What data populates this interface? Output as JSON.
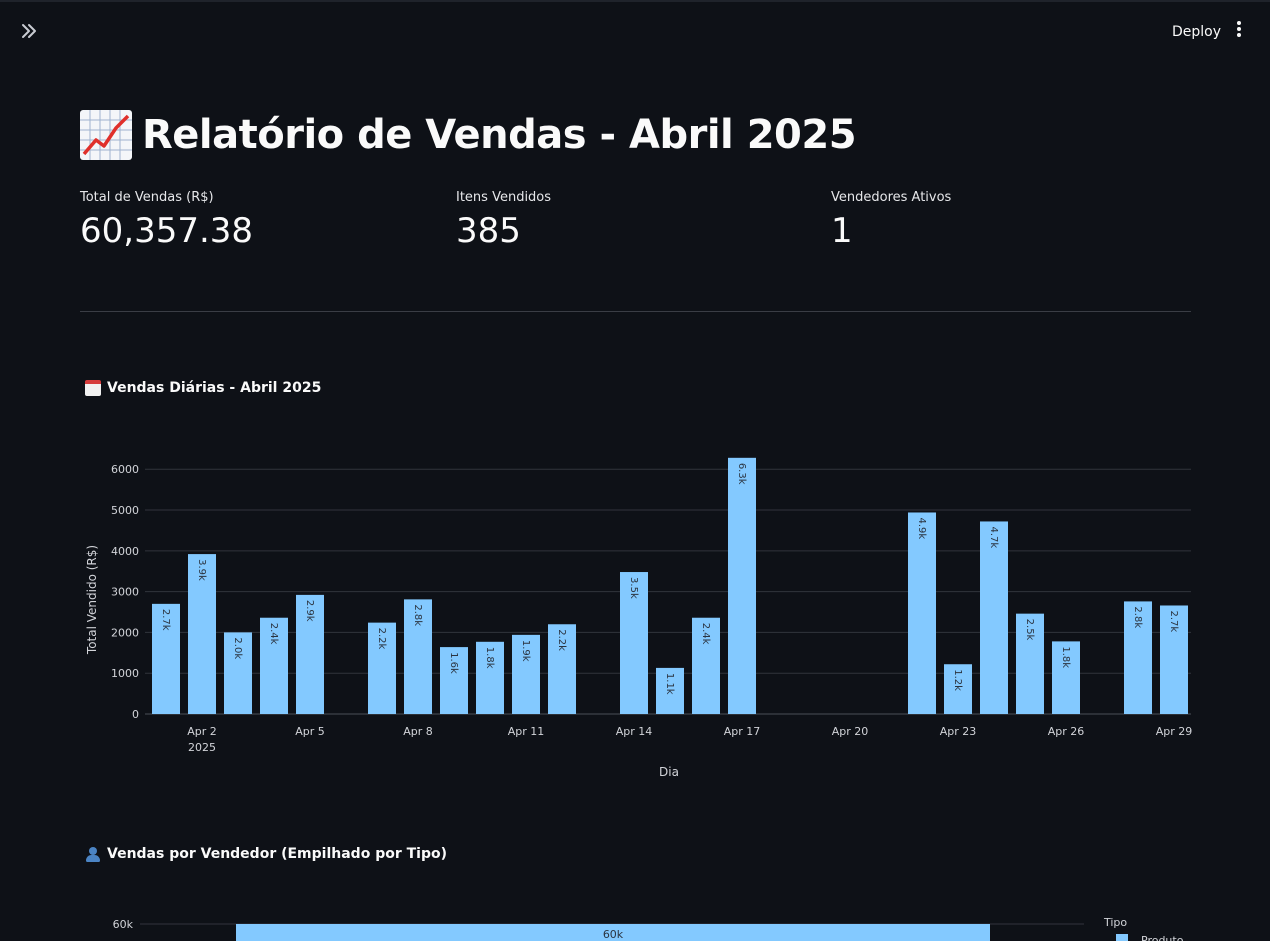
{
  "header": {
    "deploy_label": "Deploy"
  },
  "page": {
    "title": "Relatório de Vendas - Abril 2025"
  },
  "metrics": [
    {
      "label": "Total de Vendas (R$)",
      "value": "60,357.38"
    },
    {
      "label": "Itens Vendidos",
      "value": "385"
    },
    {
      "label": "Vendedores Ativos",
      "value": "1"
    }
  ],
  "sections": {
    "daily_title": "Vendas Diárias - Abril 2025",
    "seller_title": "Vendas por Vendedor (Empilhado por Tipo)"
  },
  "chart_data": [
    {
      "type": "bar",
      "xlabel": "Dia",
      "ylabel": "Total Vendido (R$)",
      "ylim": [
        0,
        6300
      ],
      "yticks": [
        0,
        1000,
        2000,
        3000,
        4000,
        5000,
        6000
      ],
      "xticks": [
        {
          "day": 2,
          "label": "Apr 2",
          "sub": "2025"
        },
        {
          "day": 5,
          "label": "Apr 5"
        },
        {
          "day": 8,
          "label": "Apr 8"
        },
        {
          "day": 11,
          "label": "Apr 11"
        },
        {
          "day": 14,
          "label": "Apr 14"
        },
        {
          "day": 17,
          "label": "Apr 17"
        },
        {
          "day": 20,
          "label": "Apr 20"
        },
        {
          "day": 23,
          "label": "Apr 23"
        },
        {
          "day": 26,
          "label": "Apr 26"
        },
        {
          "day": 29,
          "label": "Apr 29"
        }
      ],
      "grid": true,
      "bar_color": "#83c9ff",
      "x": [
        1,
        2,
        3,
        4,
        5,
        7,
        8,
        9,
        10,
        11,
        12,
        14,
        15,
        16,
        17,
        22,
        23,
        24,
        25,
        26,
        28,
        29
      ],
      "values": [
        2700,
        3920,
        2000,
        2360,
        2920,
        2240,
        2810,
        1640,
        1770,
        1940,
        2200,
        3480,
        1130,
        2360,
        6280,
        4940,
        1220,
        4720,
        2460,
        1780,
        2760,
        2660
      ],
      "labels": [
        "2.7k",
        "3.9k",
        "2.0k",
        "2.4k",
        "2.9k",
        "2.2k",
        "2.8k",
        "1.6k",
        "1.8k",
        "1.9k",
        "2.2k",
        "3.5k",
        "1.1k",
        "2.4k",
        "6.3k",
        "4.9k",
        "1.2k",
        "4.7k",
        "2.5k",
        "1.8k",
        "2.8k",
        "2.7k"
      ]
    },
    {
      "type": "bar",
      "stacked": true,
      "yticks": [
        {
          "v": 60000,
          "label": "60k"
        }
      ],
      "values": [
        60357.38
      ],
      "labels": [
        "60k"
      ],
      "legend_title": "Tipo",
      "series": [
        {
          "name": "Produto",
          "color": "#83c9ff"
        }
      ]
    }
  ]
}
